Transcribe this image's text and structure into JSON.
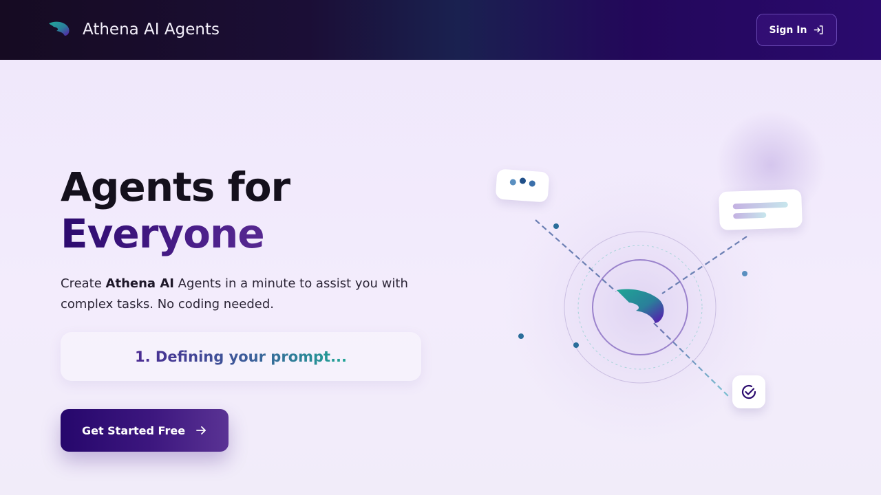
{
  "header": {
    "brand_name": "Athena AI Agents",
    "signin_label": "Sign In"
  },
  "hero": {
    "title_line1": "Agents for",
    "title_line2": "Everyone",
    "desc_prefix": "Create ",
    "desc_brand": "Athena AI",
    "desc_suffix": " Agents in a minute to assist you with complex tasks. No coding needed.",
    "prompt_step": "1. Defining your prompt...",
    "cta_label": "Get Started Free"
  },
  "icons": {
    "logo": "athena-wing-logo",
    "signin": "sign-in-arrow-icon",
    "cta": "arrow-right-icon",
    "check": "check-circle-icon"
  },
  "colors": {
    "header_dark": "#160b22",
    "header_purple": "#2a0a6e",
    "accent_purple": "#2c0a6e",
    "accent_teal": "#1fa595"
  }
}
